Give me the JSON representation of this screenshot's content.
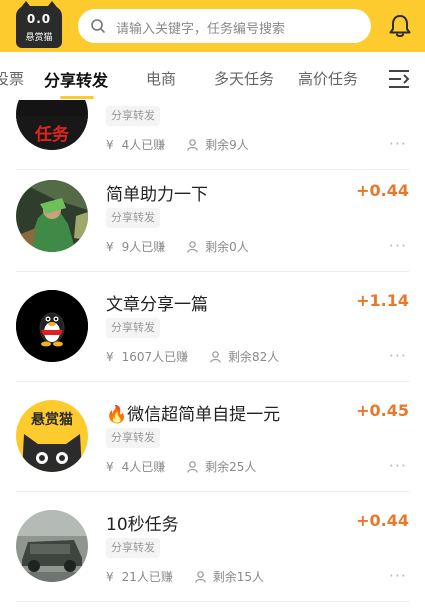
{
  "header": {
    "logo_eyes": "0.0",
    "logo_text": "悬赏猫",
    "search_placeholder": "请输入关键字，任务编号搜索",
    "accent": "#fecb2e"
  },
  "tabs": [
    {
      "label": "投票"
    },
    {
      "label": "分享转发",
      "active": true
    },
    {
      "label": "电商"
    },
    {
      "label": "多天任务"
    },
    {
      "label": "高价任务"
    }
  ],
  "tasks": [
    {
      "title": "",
      "reward": "",
      "tag": "分享转发",
      "earned": "4人已赚",
      "remaining": "剩余9人",
      "avatar": "red-character-icon",
      "avatar_text": "任务"
    },
    {
      "title": "简单助力一下",
      "reward": "+0.44",
      "tag": "分享转发",
      "earned": "9人已赚",
      "remaining": "剩余0人",
      "avatar": "game-character-icon"
    },
    {
      "title": "文章分享一篇",
      "reward": "+1.14",
      "tag": "分享转发",
      "earned": "1607人已赚",
      "remaining": "剩余82人",
      "avatar": "qq-penguin-icon"
    },
    {
      "title": "🔥微信超简单自提一元",
      "reward": "+0.45",
      "tag": "分享转发",
      "earned": "4人已赚",
      "remaining": "剩余25人",
      "avatar": "cat-logo-icon",
      "avatar_text": "悬赏猫"
    },
    {
      "title": "10秒任务",
      "reward": "+0.44",
      "tag": "分享转发",
      "earned": "21人已赚",
      "remaining": "剩余15人",
      "avatar": "car-photo-icon"
    }
  ],
  "currency_symbol": "¥",
  "more_glyph": "···",
  "reward_color": "#e8782a"
}
